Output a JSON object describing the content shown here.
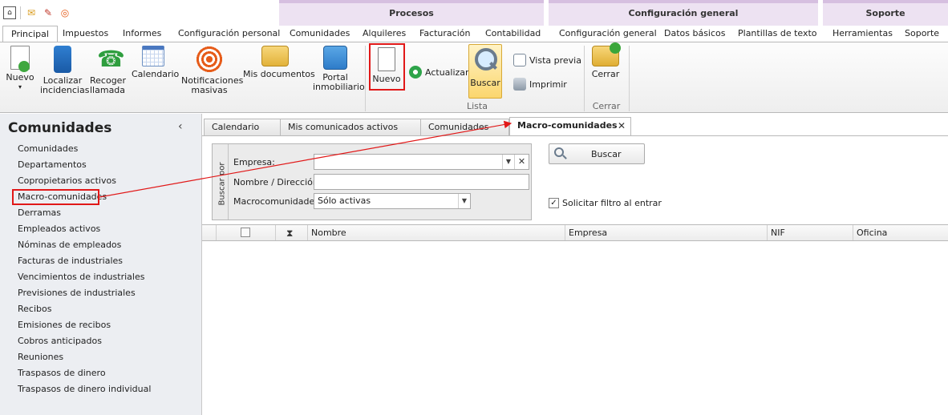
{
  "quick_access": {
    "icons": [
      "app-logo-icon",
      "mail-icon",
      "task-icon",
      "broadcast-icon"
    ]
  },
  "ribbon_groups": {
    "procesos": "Procesos",
    "configuracion": "Configuración general",
    "soporte": "Soporte"
  },
  "ribbon_tabs": {
    "principal": "Principal",
    "impuestos": "Impuestos",
    "informes": "Informes",
    "config_personal": "Configuración personal",
    "comunidades": "Comunidades",
    "alquileres": "Alquileres",
    "facturacion": "Facturación",
    "contabilidad": "Contabilidad",
    "config_general": "Configuración general",
    "datos_basicos": "Datos básicos",
    "plantillas": "Plantillas de texto",
    "herramientas": "Herramientas",
    "soporte": "Soporte"
  },
  "ribbon": {
    "nuevo_menu": "Nuevo",
    "localizar": [
      "Localizar",
      "incidencias"
    ],
    "recoger": [
      "Recoger",
      "llamada"
    ],
    "calendario": "Calendario",
    "notificaciones": [
      "Notificaciones",
      "masivas"
    ],
    "mis_documentos": "Mis documentos",
    "portal": [
      "Portal",
      "inmobiliario"
    ],
    "nuevo": "Nuevo",
    "actualizar": "Actualizar",
    "buscar": "Buscar",
    "vista_previa": "Vista previa",
    "imprimir": "Imprimir",
    "lista_group": "Lista",
    "cerrar": "Cerrar",
    "cerrar_group": "Cerrar"
  },
  "sidebar": {
    "title": "Comunidades",
    "collapse": "‹",
    "items": [
      "Comunidades",
      "Departamentos",
      "Copropietarios activos",
      "Macro-comunidades",
      "Derramas",
      "Empleados activos",
      "Nóminas de empleados",
      "Facturas de industriales",
      "Vencimientos de industriales",
      "Previsiones de industriales",
      "Recibos",
      "Emisiones de recibos",
      "Cobros anticipados",
      "Reuniones",
      "Traspasos de dinero",
      "Traspasos de dinero individual"
    ],
    "selected_index": 3
  },
  "doc_tabs": {
    "calendario": "Calendario",
    "mis_comunicados": "Mis comunicados activos",
    "comunidades": "Comunidades",
    "macro": "Macro-comunidades",
    "close": "✕"
  },
  "filter": {
    "side_label": "Buscar por",
    "empresa_label": "Empresa:",
    "empresa_value": "",
    "nombre_label": "Nombre / Dirección:",
    "nombre_value": "",
    "macro_label": "Macrocomunidades:",
    "macro_value": "Sólo activas",
    "search_button": "Buscar",
    "solicitar_label": "Solicitar filtro al entrar",
    "solicitar_checked": true
  },
  "grid": {
    "columns": [
      "Nombre",
      "Empresa",
      "NIF",
      "Oficina"
    ],
    "rows": []
  },
  "colors": {
    "highlight_red": "#e11818",
    "group_header": "#ede2f2",
    "buscar_active": "#fbd66e"
  }
}
